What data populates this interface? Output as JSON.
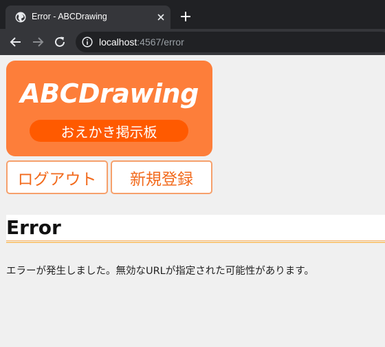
{
  "browser": {
    "tab": {
      "title": "Error - ABCDrawing",
      "favicon": "globe-icon"
    },
    "new_tab_icon": "plus-icon",
    "address": {
      "host": "localhost",
      "path": ":4567/error",
      "icon": "info-icon"
    }
  },
  "site": {
    "logo": {
      "title": "ABCDrawing",
      "subtitle": "おえかき掲示板"
    },
    "nav": {
      "logout_label": "ログアウト",
      "register_label": "新規登録"
    }
  },
  "content": {
    "heading": "Error",
    "message": "エラーが発生しました。無効なURLが指定された可能性があります。"
  },
  "colors": {
    "accent": "#fd7e3a",
    "accent_dark": "#ff5a00",
    "button_text": "#f26a1c",
    "rule": "#f8c87d"
  }
}
